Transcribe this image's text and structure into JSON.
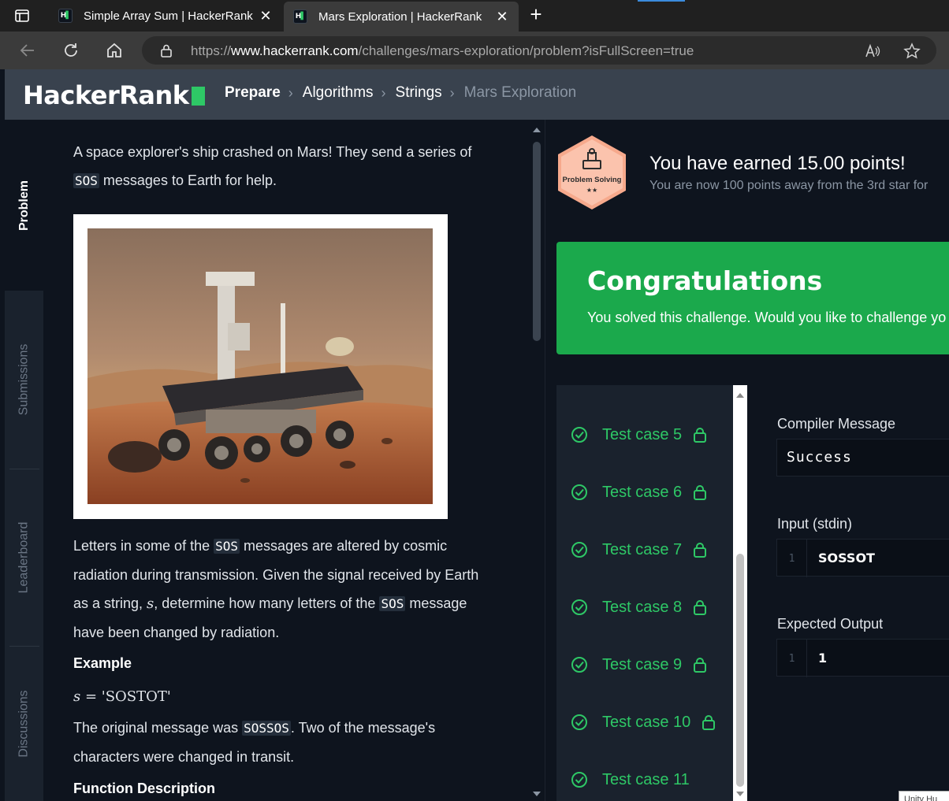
{
  "browser": {
    "tabs": [
      {
        "title": "Simple Array Sum | HackerRank"
      },
      {
        "title": "Mars Exploration | HackerRank"
      }
    ],
    "url": {
      "protocol": "https://",
      "host": "www.hackerrank.com",
      "path": "/challenges/mars-exploration/problem?isFullScreen=true"
    }
  },
  "header": {
    "logo": "HackerRank",
    "breadcrumbs": [
      "Prepare",
      "Algorithms",
      "Strings",
      "Mars Exploration"
    ]
  },
  "side_tabs": [
    "Problem",
    "Submissions",
    "Leaderboard",
    "Discussions"
  ],
  "problem": {
    "intro_1": "A space explorer's ship crashed on Mars! They send a series of",
    "intro_2_code": "SOS",
    "intro_2_rest": " messages to Earth for help.",
    "para_1": "Letters in some of the",
    "para_1_code": "SOS",
    "para_1_rest": " messages are altered by cosmic",
    "para_2": "radiation during transmission. Given the signal received by Earth",
    "para_3_a": "as a string, ",
    "para_3_var": "s",
    "para_3_b": ", determine how many letters of the ",
    "para_3_code": "SOS",
    "para_3_c": " message",
    "para_4": "have been changed by radiation.",
    "example_heading": "Example",
    "example_var": "s",
    "example_eq": " = 'SOSTOT'",
    "orig_a": "The original message was ",
    "orig_code": "SOSSOS",
    "orig_b": ". Two of the message's",
    "orig_2": "characters were changed in transit.",
    "function_heading": "Function Description"
  },
  "result": {
    "badge_label": "Problem Solving",
    "badge_stars": "★★",
    "earned": "You have earned 15.00 points!",
    "away": "You are now 100 points away from the 3rd star for",
    "congrats_title": "Congratulations",
    "congrats_sub": "You solved this challenge. Would you like to challenge yo"
  },
  "test_cases": [
    "Test case 5",
    "Test case 6",
    "Test case 7",
    "Test case 8",
    "Test case 9",
    "Test case 10",
    "Test case 11"
  ],
  "details": {
    "compiler_label": "Compiler Message",
    "compiler_value": "Success",
    "input_label": "Input (stdin)",
    "input_line": "1",
    "input_value": "SOSSOT",
    "expected_label": "Expected Output",
    "expected_line": "1",
    "expected_value": "1"
  },
  "tooltip": "Unity Hu",
  "colors": {
    "accent_green": "#2ec866",
    "success_banner": "#1ba94c",
    "header_bg": "#39424e",
    "page_bg": "#0e141e"
  }
}
